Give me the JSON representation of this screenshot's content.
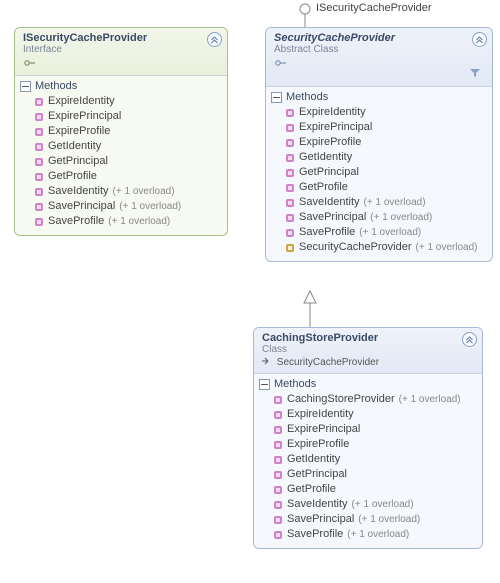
{
  "lollipop_label": "ISecurityCacheProvider",
  "overload_suffix": "(+ 1 overload)",
  "section_label_methods": "Methods",
  "boxes": {
    "iface": {
      "title": "ISecurityCacheProvider",
      "stereotype": "Interface",
      "methods": [
        {
          "name": "ExpireIdentity",
          "icon": "method",
          "overloads": false
        },
        {
          "name": "ExpirePrincipal",
          "icon": "method",
          "overloads": false
        },
        {
          "name": "ExpireProfile",
          "icon": "method",
          "overloads": false
        },
        {
          "name": "GetIdentity",
          "icon": "method",
          "overloads": false
        },
        {
          "name": "GetPrincipal",
          "icon": "method",
          "overloads": false
        },
        {
          "name": "GetProfile",
          "icon": "method",
          "overloads": false
        },
        {
          "name": "SaveIdentity",
          "icon": "method",
          "overloads": true
        },
        {
          "name": "SavePrincipal",
          "icon": "method",
          "overloads": true
        },
        {
          "name": "SaveProfile",
          "icon": "method",
          "overloads": true
        }
      ]
    },
    "abs": {
      "title": "SecurityCacheProvider",
      "stereotype": "Abstract Class",
      "methods": [
        {
          "name": "ExpireIdentity",
          "icon": "method",
          "overloads": false
        },
        {
          "name": "ExpirePrincipal",
          "icon": "method",
          "overloads": false
        },
        {
          "name": "ExpireProfile",
          "icon": "method",
          "overloads": false
        },
        {
          "name": "GetIdentity",
          "icon": "method",
          "overloads": false
        },
        {
          "name": "GetPrincipal",
          "icon": "method",
          "overloads": false
        },
        {
          "name": "GetProfile",
          "icon": "method",
          "overloads": false
        },
        {
          "name": "SaveIdentity",
          "icon": "method",
          "overloads": true
        },
        {
          "name": "SavePrincipal",
          "icon": "method",
          "overloads": true
        },
        {
          "name": "SaveProfile",
          "icon": "method",
          "overloads": true
        },
        {
          "name": "SecurityCacheProvider",
          "icon": "ctor",
          "overloads": true
        }
      ]
    },
    "impl": {
      "title": "CachingStoreProvider",
      "stereotype": "Class",
      "inherits": "SecurityCacheProvider",
      "methods": [
        {
          "name": "CachingStoreProvider",
          "icon": "method",
          "overloads": true
        },
        {
          "name": "ExpireIdentity",
          "icon": "method",
          "overloads": false
        },
        {
          "name": "ExpirePrincipal",
          "icon": "method",
          "overloads": false
        },
        {
          "name": "ExpireProfile",
          "icon": "method",
          "overloads": false
        },
        {
          "name": "GetIdentity",
          "icon": "method",
          "overloads": false
        },
        {
          "name": "GetPrincipal",
          "icon": "method",
          "overloads": false
        },
        {
          "name": "GetProfile",
          "icon": "method",
          "overloads": false
        },
        {
          "name": "SaveIdentity",
          "icon": "method",
          "overloads": true
        },
        {
          "name": "SavePrincipal",
          "icon": "method",
          "overloads": true
        },
        {
          "name": "SaveProfile",
          "icon": "method",
          "overloads": true
        }
      ]
    }
  }
}
